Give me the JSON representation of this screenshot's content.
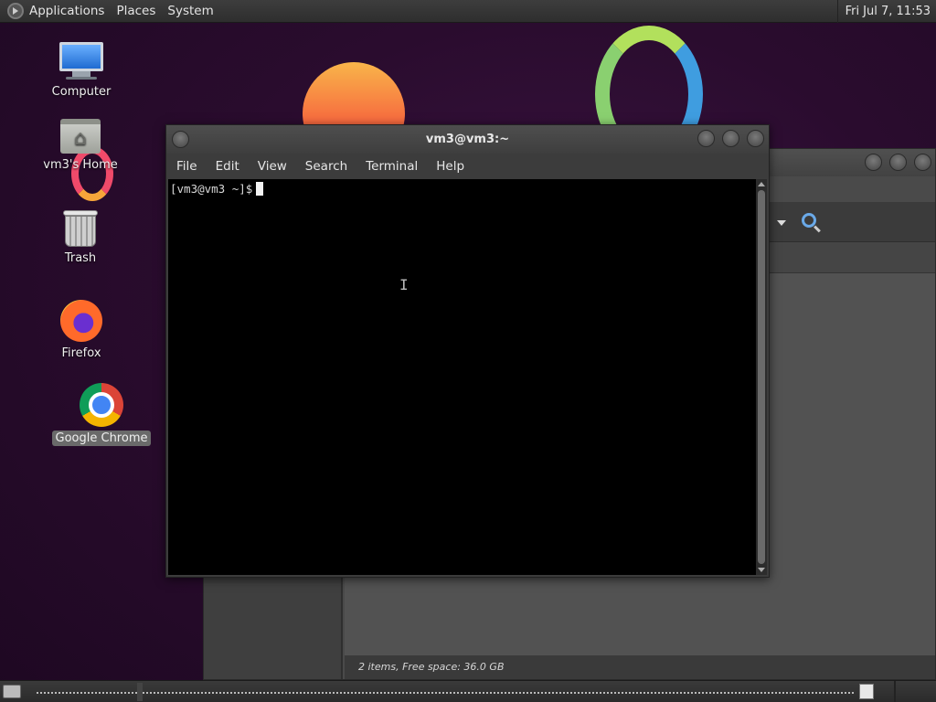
{
  "top_panel": {
    "menus": [
      "Applications",
      "Places",
      "System"
    ],
    "clock": "Fri Jul  7, 11:53"
  },
  "desktop": {
    "icons": [
      {
        "label": "Computer",
        "icon": "computer-icon"
      },
      {
        "label": "vm3's Home",
        "icon": "home-folder-icon"
      },
      {
        "label": "Trash",
        "icon": "trash-icon"
      },
      {
        "label": "Firefox",
        "icon": "firefox-icon"
      },
      {
        "label": "Google Chrome",
        "icon": "chrome-icon",
        "selected": true
      }
    ]
  },
  "terminal": {
    "title": "vm3@vm3:~",
    "menus": [
      "File",
      "Edit",
      "View",
      "Search",
      "Terminal",
      "Help"
    ],
    "prompt": "[vm3@vm3 ~]$"
  },
  "file_manager": {
    "status": "2 items, Free space: 36.0 GB"
  },
  "colors": {
    "desktop_bg": "#2a0c2e",
    "panel_bg": "#333333",
    "terminal_bg": "#000000",
    "accent_selection": "#6a6a6a"
  }
}
